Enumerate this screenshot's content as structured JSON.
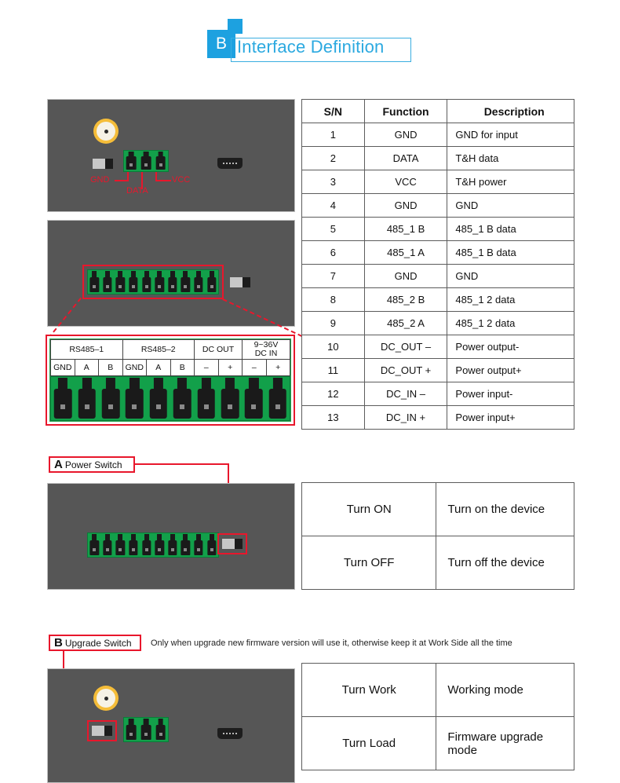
{
  "header": {
    "badge_letter": "B",
    "title": "Interface Definition"
  },
  "pin_table": {
    "columns": [
      "S/N",
      "Function",
      "Description"
    ],
    "rows": [
      [
        "1",
        "GND",
        "GND for input"
      ],
      [
        "2",
        "DATA",
        "T&H data"
      ],
      [
        "3",
        "VCC",
        "T&H power"
      ],
      [
        "4",
        "GND",
        "GND"
      ],
      [
        "5",
        "485_1  B",
        "485_1 B data"
      ],
      [
        "6",
        "485_1  A",
        "485_1 B data"
      ],
      [
        "7",
        "GND",
        "GND"
      ],
      [
        "8",
        "485_2  B",
        "485_1 2 data"
      ],
      [
        "9",
        "485_2  A",
        "485_1 2 data"
      ],
      [
        "10",
        "DC_OUT –",
        "Power output-"
      ],
      [
        "11",
        "DC_OUT +",
        "Power output+"
      ],
      [
        "12",
        "DC_IN –",
        "Power  input-"
      ],
      [
        "13",
        "DC_IN +",
        "Power input+"
      ]
    ]
  },
  "sensor_panel": {
    "labels": {
      "gnd": "GND",
      "data": "DATA",
      "vcc": "VCC"
    }
  },
  "connector_detail": {
    "groups": [
      {
        "label": "RS485-1",
        "span": 3
      },
      {
        "label": "RS485-2",
        "span": 3
      },
      {
        "label": "DC OUT",
        "span": 2
      },
      {
        "label": "9~36V\nDC IN",
        "span": 2
      }
    ],
    "group_labels": [
      "RS485–1",
      "RS485–2",
      "DC OUT",
      "9~36V DC IN"
    ],
    "dc_in_line1": "9~36V",
    "dc_in_line2": "DC IN",
    "pins": [
      "GND",
      "A",
      "B",
      "GND",
      "A",
      "B",
      "–",
      "+",
      "–",
      "+"
    ]
  },
  "power_switch": {
    "badge_letter": "A",
    "badge_text": "Power Switch",
    "table": {
      "rows": [
        [
          "Turn ON",
          "Turn on the device"
        ],
        [
          "Turn OFF",
          "Turn off the device"
        ]
      ]
    }
  },
  "upgrade_switch": {
    "badge_letter": "B",
    "badge_text": "Upgrade Switch",
    "note": "Only when upgrade new firmware version will use it, otherwise keep it at Work Side all the time",
    "table": {
      "rows": [
        [
          "Turn Work",
          "Working mode"
        ],
        [
          "Turn Load",
          "Firmware upgrade mode"
        ]
      ]
    }
  },
  "colors": {
    "accent": "#2ba9e0",
    "annotation": "#e8172c",
    "terminal_green": "#12a04a",
    "panel_gray": "#565656"
  }
}
